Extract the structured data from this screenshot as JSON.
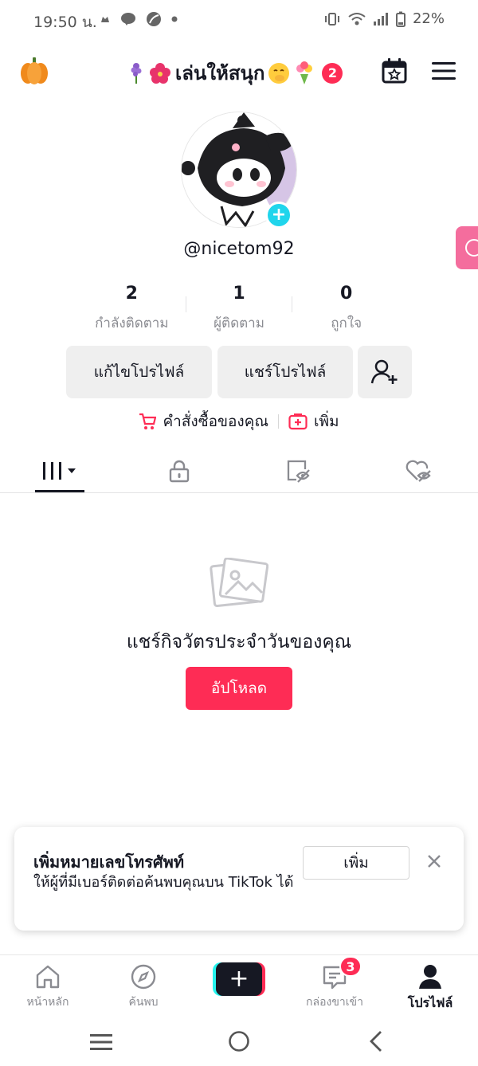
{
  "status_bar": {
    "time": "19:50 น.",
    "battery": "22%"
  },
  "header": {
    "title": "เล่นให้สนุก",
    "notification_count": "2"
  },
  "profile": {
    "username": "@nicetom92",
    "stats": [
      {
        "value": "2",
        "label": "กำลังติดตาม"
      },
      {
        "value": "1",
        "label": "ผู้ติดตาม"
      },
      {
        "value": "0",
        "label": "ถูกใจ"
      }
    ],
    "edit_button": "แก้ไขโปรไฟล์",
    "share_button": "แชร์โปรไฟล์"
  },
  "links": {
    "orders": "คำสั่งซื้อของคุณ",
    "add": "เพิ่ม"
  },
  "empty_state": {
    "message": "แชร์กิจวัตรประจำวันของคุณ",
    "upload_button": "อัปโหลด"
  },
  "phone_card": {
    "title": "เพิ่มหมายเลขโทรศัพท์",
    "description": "ให้ผู้ที่มีเบอร์ติดต่อค้นพบคุณบน TikTok ได้",
    "add_button": "เพิ่ม"
  },
  "bottom_nav": {
    "home": "หน้าหลัก",
    "discover": "ค้นพบ",
    "inbox": "กล่องขาเข้า",
    "inbox_badge": "3",
    "profile": "โปรไฟล์"
  },
  "colors": {
    "accent": "#fe2c55",
    "cyan": "#20d5ec",
    "text": "#161823",
    "muted": "#8a8b91"
  }
}
